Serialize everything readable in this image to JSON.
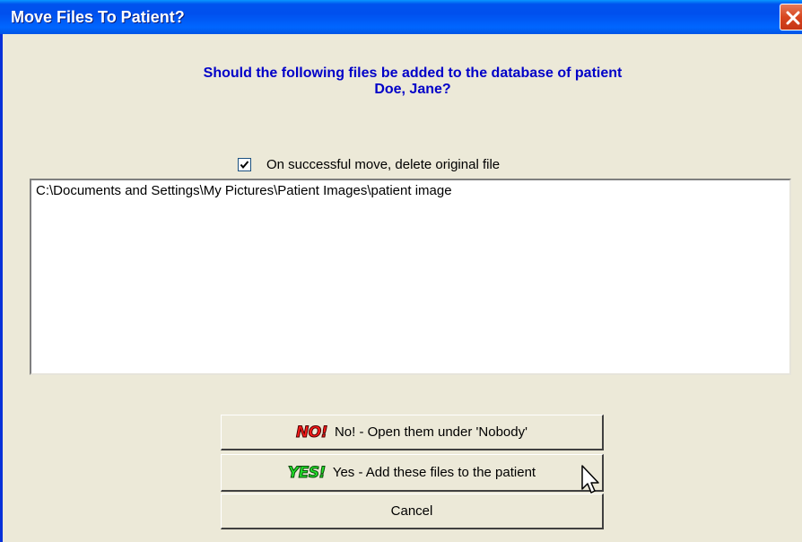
{
  "window": {
    "title": "Move Files To Patient?",
    "close_icon": "close-icon",
    "colors": {
      "titlebar": "#0054e3",
      "close": "#d8461f",
      "body": "#ece9d8",
      "question_text": "#0000c8"
    }
  },
  "prompt": {
    "line1": "Should the following files be added to the database of patient",
    "line2": "Doe, Jane?"
  },
  "options": {
    "delete_original": {
      "label": "On successful move, delete original file",
      "checked": true
    }
  },
  "files": [
    "C:\\Documents and Settings\\My Pictures\\Patient Images\\patient image"
  ],
  "buttons": {
    "no": {
      "badge": "NO!",
      "label": "No! - Open them under 'Nobody'",
      "badge_color": "#ff1a1a"
    },
    "yes": {
      "badge": "YES!",
      "label": "Yes - Add these files to the patient",
      "badge_color": "#22e02a"
    },
    "cancel": {
      "label": "Cancel"
    }
  }
}
